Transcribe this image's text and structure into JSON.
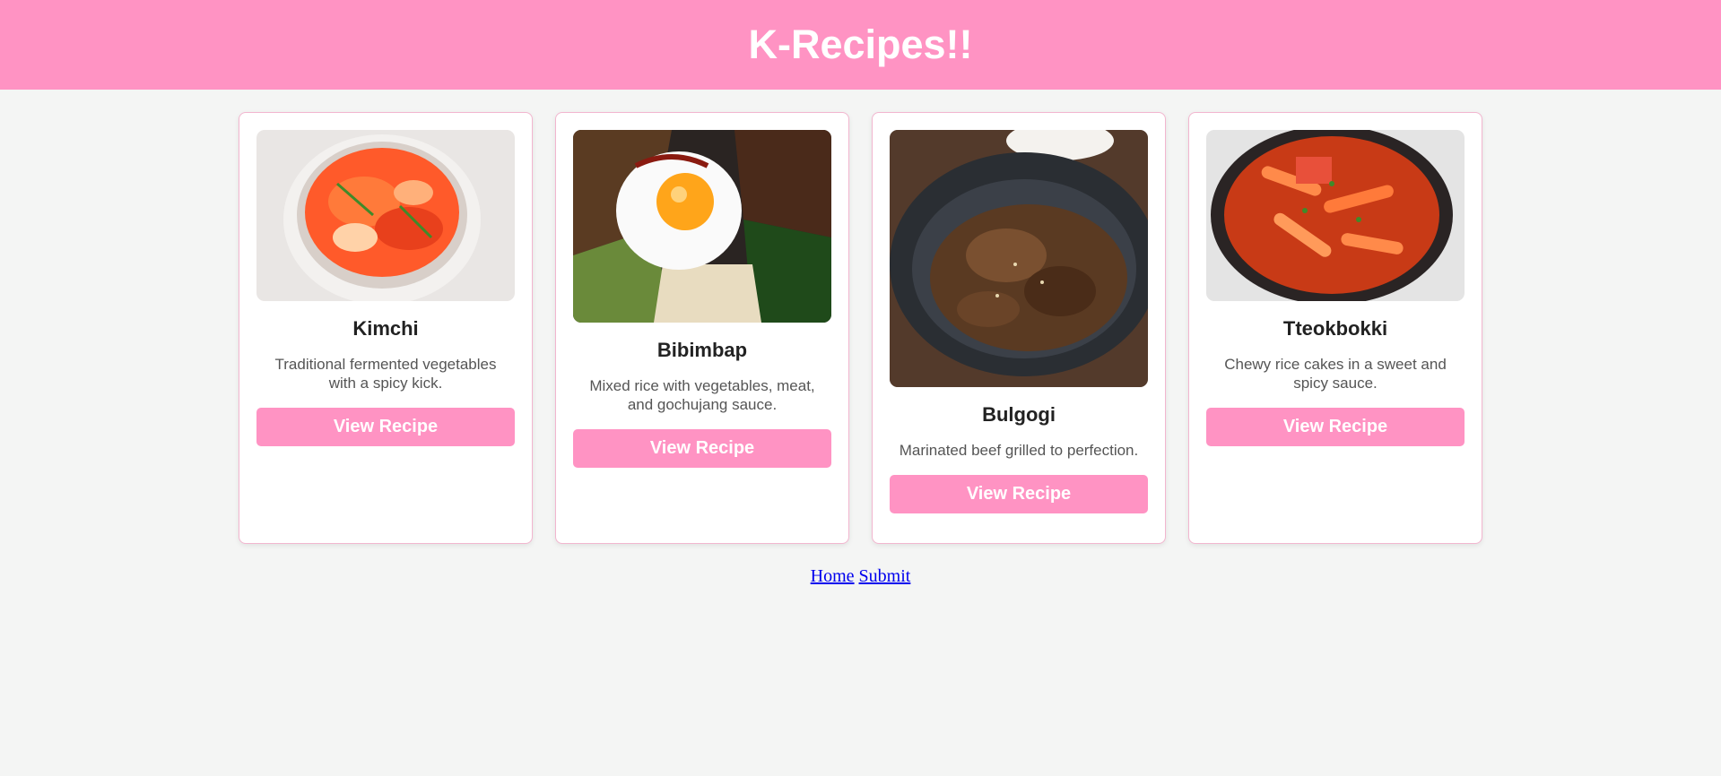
{
  "header": {
    "title": "K-Recipes!!"
  },
  "colors": {
    "header_bg": "#ff93c3",
    "button_bg": "#ff93c3",
    "page_bg": "#f4f5f4",
    "card_border": "#f2b6cf"
  },
  "recipes": [
    {
      "title": "Kimchi",
      "description": "Traditional fermented vegetables with a spicy kick.",
      "button": "View Recipe",
      "image": "kimchi-bowl"
    },
    {
      "title": "Bibimbap",
      "description": "Mixed rice with vegetables, meat, and gochujang sauce.",
      "button": "View Recipe",
      "image": "bibimbap-bowl"
    },
    {
      "title": "Bulgogi",
      "description": "Marinated beef grilled to perfection.",
      "button": "View Recipe",
      "image": "bulgogi-plate"
    },
    {
      "title": "Tteokbokki",
      "description": "Chewy rice cakes in a sweet and spicy sauce.",
      "button": "View Recipe",
      "image": "tteokbokki-skillet"
    }
  ],
  "footer": {
    "links": [
      "Home",
      "Submit"
    ]
  }
}
